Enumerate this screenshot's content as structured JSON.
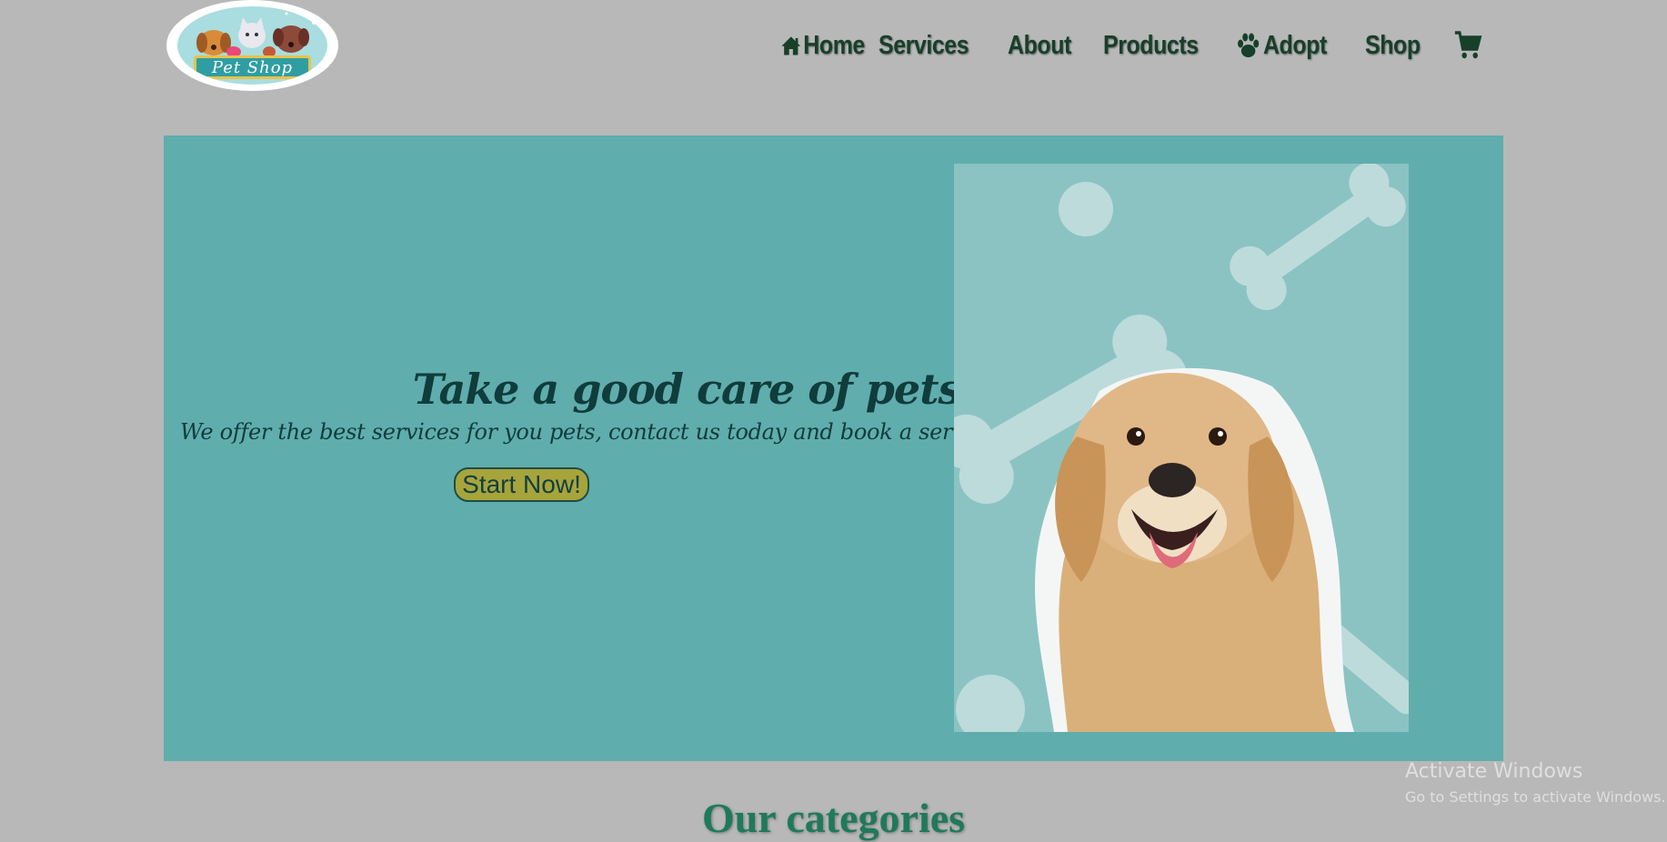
{
  "header": {
    "logo_text": "Pet Shop",
    "nav": [
      {
        "label": "Home",
        "icon": "home-icon"
      },
      {
        "label": "Services",
        "icon": ""
      },
      {
        "label": "About",
        "icon": ""
      },
      {
        "label": "Products",
        "icon": ""
      },
      {
        "label": "Adopt",
        "icon": "paw-icon"
      },
      {
        "label": "Shop",
        "icon": ""
      }
    ],
    "cart_icon": "cart-icon"
  },
  "hero": {
    "title": "Take a good care of pets",
    "subtitle": "We offer the best services for you pets, contact us today and book a services",
    "cta_label": "Start Now!",
    "image_alt": "golden retriever dog"
  },
  "sections": {
    "categories_title": "Our categories"
  },
  "watermark": {
    "title": "Activate Windows",
    "subtitle": "Go to Settings to activate Windows."
  },
  "colors": {
    "page_bg": "#b8b8b8",
    "hero_bg": "#60adad",
    "nav_text": "#173f2a",
    "button_bg": "#a8a43c",
    "heading_green": "#1e7a5a"
  }
}
